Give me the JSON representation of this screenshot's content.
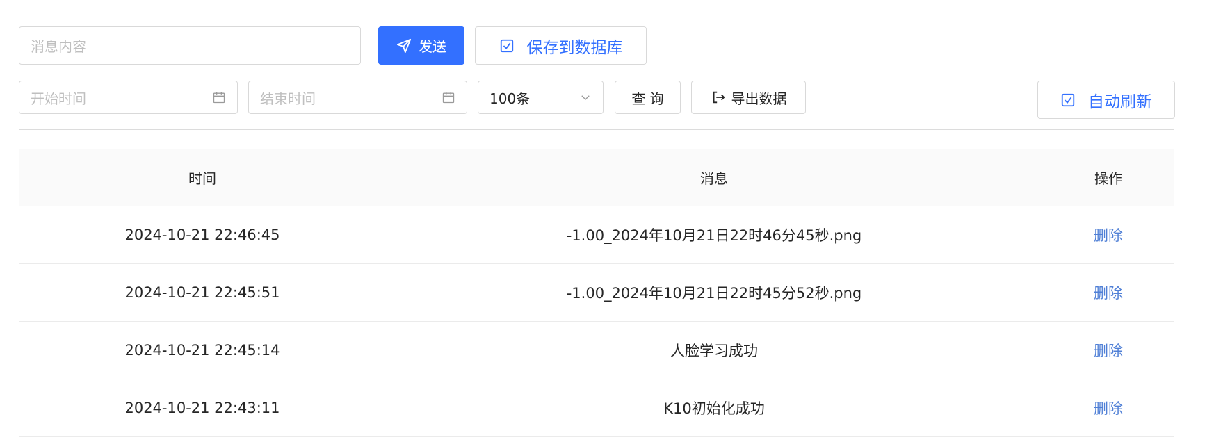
{
  "toolbar": {
    "message_placeholder": "消息内容",
    "send_label": "发送",
    "save_db_label": "保存到数据库",
    "start_time_placeholder": "开始时间",
    "end_time_placeholder": "结束时间",
    "limit_value": "100条",
    "query_label": "查 询",
    "export_label": "导出数据",
    "auto_refresh_label": "自动刷新"
  },
  "colors": {
    "primary": "#3370ff",
    "link": "#4f7fd6",
    "header_bg": "#fafafa",
    "border": "#d9d9d9"
  },
  "icons": {
    "send": "send-icon",
    "save_db_check": "checkbox-checked-icon",
    "calendar": "calendar-icon",
    "dropdown": "chevron-down-icon",
    "export": "export-icon",
    "auto_refresh_check": "checkbox-checked-icon"
  },
  "table": {
    "columns": [
      "时间",
      "消息",
      "操作"
    ],
    "rows": [
      {
        "time": "2024-10-21 22:46:45",
        "message": "-1.00_2024年10月21日22时46分45秒.png",
        "action": "删除"
      },
      {
        "time": "2024-10-21 22:45:51",
        "message": "-1.00_2024年10月21日22时45分52秒.png",
        "action": "删除"
      },
      {
        "time": "2024-10-21 22:45:14",
        "message": "人脸学习成功",
        "action": "删除"
      },
      {
        "time": "2024-10-21 22:43:11",
        "message": "K10初始化成功",
        "action": "删除"
      }
    ]
  }
}
